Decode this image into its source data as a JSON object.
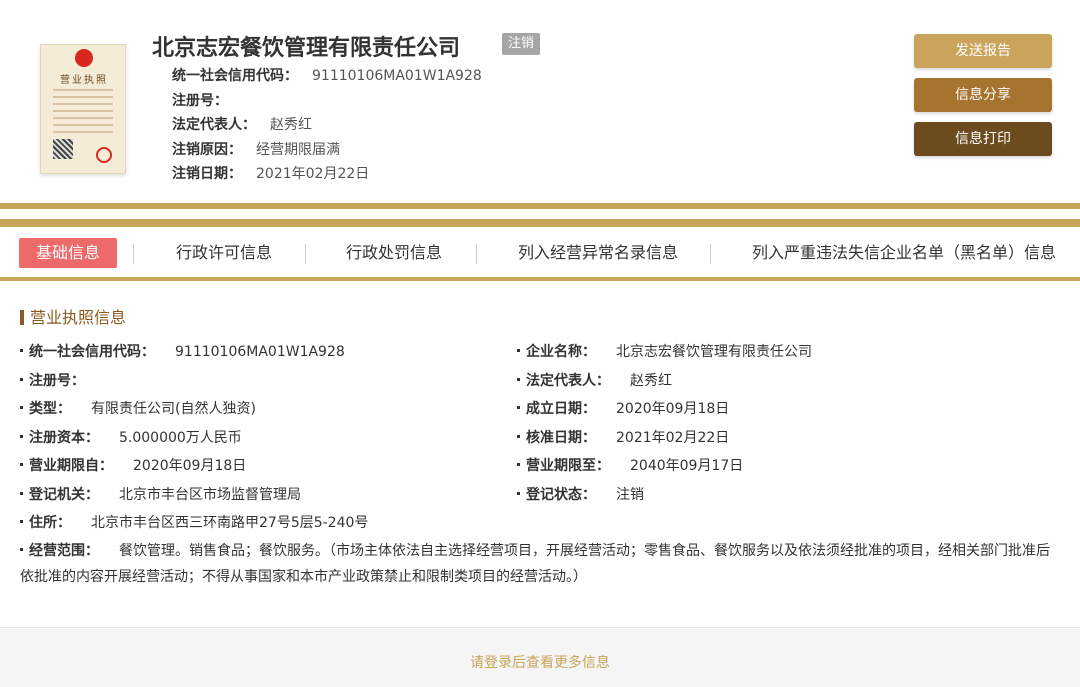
{
  "header": {
    "license_image_label": "营业执照",
    "company_name": "北京志宏餐饮管理有限责任公司",
    "status_tag": "注销",
    "rows": [
      {
        "key": "统一社会信用代码：",
        "value": "91110106MA01W1A928"
      },
      {
        "key": "注册号：",
        "value": ""
      },
      {
        "key": "法定代表人：",
        "value": "赵秀红"
      },
      {
        "key": "注销原因：",
        "value": "经营期限届满"
      },
      {
        "key": "注销日期：",
        "value": "2021年02月22日"
      }
    ],
    "buttons": {
      "report": "发送报告",
      "share": "信息分享",
      "print": "信息打印"
    }
  },
  "tabs": [
    {
      "label": "基础信息",
      "active": true
    },
    {
      "label": "行政许可信息"
    },
    {
      "label": "行政处罚信息"
    },
    {
      "label": "列入经营异常名录信息"
    },
    {
      "label": "列入严重违法失信企业名单（黑名单）信息"
    }
  ],
  "section": {
    "title": "营业执照信息",
    "left": [
      {
        "key": "统一社会信用代码：",
        "value": "91110106MA01W1A928"
      },
      {
        "key": "注册号：",
        "value": ""
      },
      {
        "key": "类型：",
        "value": "有限责任公司(自然人独资)"
      },
      {
        "key": "注册资本：",
        "value": "5.000000万人民币"
      },
      {
        "key": "营业期限自：",
        "value": "2020年09月18日"
      },
      {
        "key": "登记机关：",
        "value": "北京市丰台区市场监督管理局"
      },
      {
        "key": "住所：",
        "value": "北京市丰台区西三环南路甲27号5层5-240号"
      }
    ],
    "right": [
      {
        "key": "企业名称：",
        "value": "北京志宏餐饮管理有限责任公司"
      },
      {
        "key": "法定代表人：",
        "value": "赵秀红"
      },
      {
        "key": "成立日期：",
        "value": "2020年09月18日"
      },
      {
        "key": "核准日期：",
        "value": "2021年02月22日"
      },
      {
        "key": "营业期限至：",
        "value": "2040年09月17日"
      },
      {
        "key": "登记状态：",
        "value": "注销"
      }
    ],
    "scope": {
      "key": "经营范围：",
      "value": "餐饮管理。销售食品；餐饮服务。（市场主体依法自主选择经营项目，开展经营活动；零售食品、餐饮服务以及依法须经批准的项目，经相关部门批准后依批准的内容开展经营活动；不得从事国家和本市产业政策禁止和限制类项目的经营活动。）"
    }
  },
  "footer": {
    "login_text": "请登录后查看更多信息"
  },
  "colors": {
    "gold": "#c9a45a",
    "brown": "#a7742f",
    "dark_brown": "#6c4c1e",
    "active_tab": "#ee6a6a",
    "section_title": "#8a5a22"
  }
}
